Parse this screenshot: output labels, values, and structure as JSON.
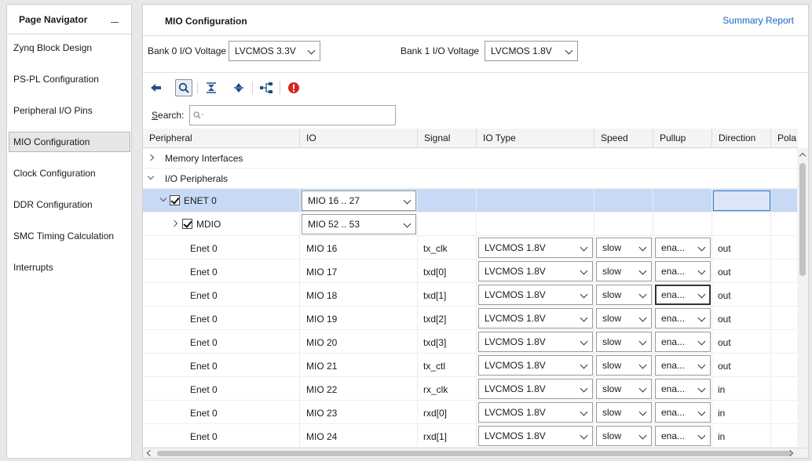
{
  "navigator": {
    "title": "Page Navigator",
    "items": [
      {
        "label": "Zynq Block Design"
      },
      {
        "label": "PS-PL Configuration"
      },
      {
        "label": "Peripheral I/O Pins"
      },
      {
        "label": "MIO Configuration",
        "selected": true
      },
      {
        "label": "Clock Configuration"
      },
      {
        "label": "DDR Configuration"
      },
      {
        "label": "SMC Timing Calculation"
      },
      {
        "label": "Interrupts"
      }
    ]
  },
  "main": {
    "title": "MIO Configuration",
    "summary_link": "Summary Report",
    "bank0": {
      "label": "Bank 0 I/O Voltage",
      "value": "LVCMOS 3.3V"
    },
    "bank1": {
      "label": "Bank 1 I/O Voltage",
      "value": "LVCMOS 1.8V"
    },
    "toolbar": [
      "back-arrow-icon",
      "search-icon",
      "collapse-all-icon",
      "expand-all-icon",
      "hierarchy-icon",
      "error-icon"
    ],
    "search": {
      "label_underlined": "S",
      "label_rest": "earch:",
      "placeholder": "Q-"
    }
  },
  "table": {
    "columns": [
      "Peripheral",
      "IO",
      "Signal",
      "IO Type",
      "Speed",
      "Pullup",
      "Direction",
      "Pola"
    ],
    "groups": {
      "memory": "Memory Interfaces",
      "io": "I/O Peripherals"
    },
    "enet": {
      "label": "ENET 0",
      "io": "MIO 16 .. 27"
    },
    "mdio": {
      "label": "MDIO",
      "io": "MIO 52 .. 53"
    },
    "rows": [
      {
        "peripheral": "Enet 0",
        "io": "MIO 16",
        "signal": "tx_clk",
        "iotype": "LVCMOS 1.8V",
        "speed": "slow",
        "pullup": "ena...",
        "direction": "out"
      },
      {
        "peripheral": "Enet 0",
        "io": "MIO 17",
        "signal": "txd[0]",
        "iotype": "LVCMOS 1.8V",
        "speed": "slow",
        "pullup": "ena...",
        "direction": "out"
      },
      {
        "peripheral": "Enet 0",
        "io": "MIO 18",
        "signal": "txd[1]",
        "iotype": "LVCMOS 1.8V",
        "speed": "slow",
        "pullup": "ena...",
        "direction": "out"
      },
      {
        "peripheral": "Enet 0",
        "io": "MIO 19",
        "signal": "txd[2]",
        "iotype": "LVCMOS 1.8V",
        "speed": "slow",
        "pullup": "ena...",
        "direction": "out"
      },
      {
        "peripheral": "Enet 0",
        "io": "MIO 20",
        "signal": "txd[3]",
        "iotype": "LVCMOS 1.8V",
        "speed": "slow",
        "pullup": "ena...",
        "direction": "out"
      },
      {
        "peripheral": "Enet 0",
        "io": "MIO 21",
        "signal": "tx_ctl",
        "iotype": "LVCMOS 1.8V",
        "speed": "slow",
        "pullup": "ena...",
        "direction": "out"
      },
      {
        "peripheral": "Enet 0",
        "io": "MIO 22",
        "signal": "rx_clk",
        "iotype": "LVCMOS 1.8V",
        "speed": "slow",
        "pullup": "ena...",
        "direction": "in"
      },
      {
        "peripheral": "Enet 0",
        "io": "MIO 23",
        "signal": "rxd[0]",
        "iotype": "LVCMOS 1.8V",
        "speed": "slow",
        "pullup": "ena...",
        "direction": "in"
      },
      {
        "peripheral": "Enet 0",
        "io": "MIO 24",
        "signal": "rxd[1]",
        "iotype": "LVCMOS 1.8V",
        "speed": "slow",
        "pullup": "ena...",
        "direction": "in"
      }
    ]
  },
  "colors": {
    "link": "#1a64c8",
    "selected_row": "#c7d9f5",
    "error": "#d9231f",
    "toolbar_icon": "#1f4e8c"
  }
}
